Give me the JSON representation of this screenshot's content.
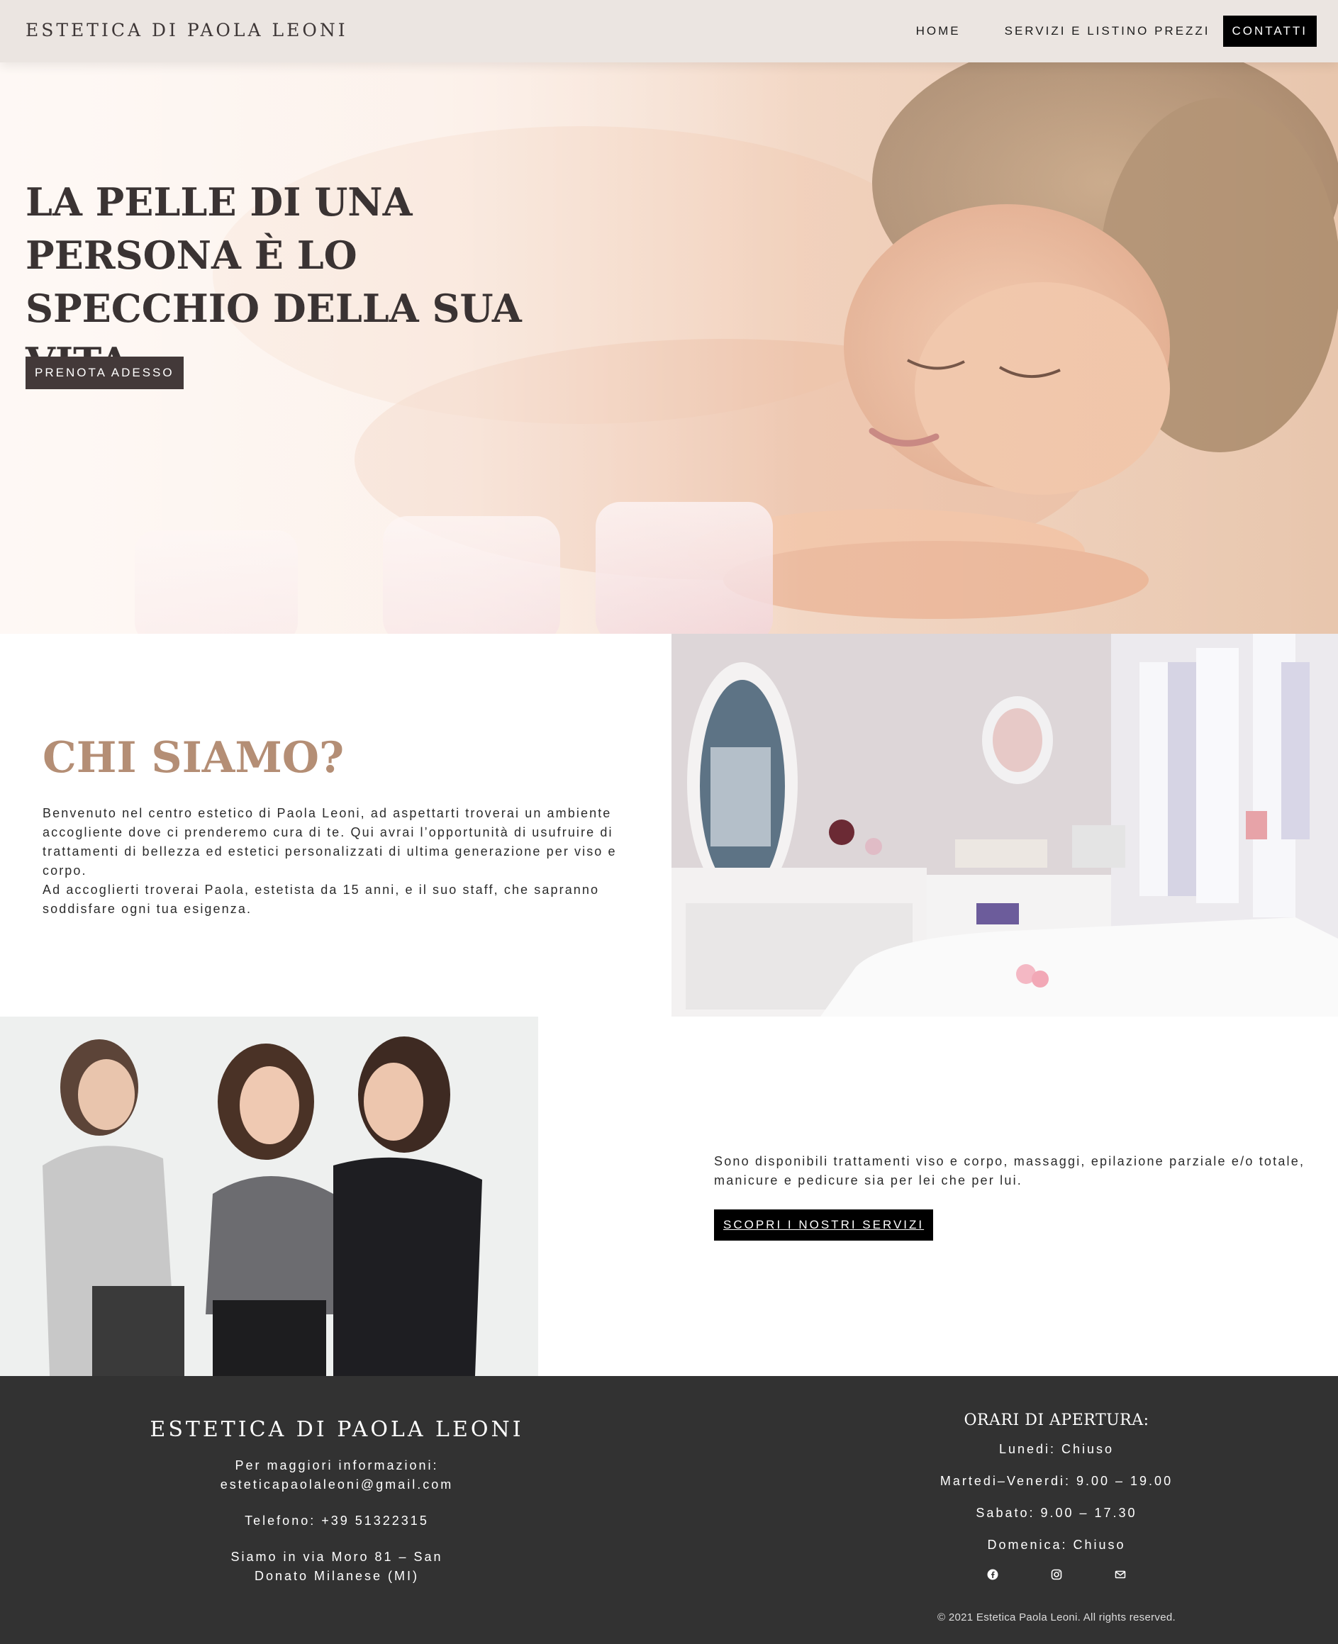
{
  "header": {
    "brand": "ESTETICA DI PAOLA LEONI",
    "nav": [
      {
        "label": "HOME"
      },
      {
        "label": "SERVIZI E LISTINO PREZZI"
      },
      {
        "label": "CONTATTI"
      }
    ]
  },
  "hero": {
    "title": "LA PELLE DI UNA PERSONA È LO SPECCHIO DELLA SUA VITA",
    "cta": "PRENOTA ADESSO"
  },
  "about": {
    "title": "CHI SIAMO?",
    "paragraph_1": "Benvenuto nel centro estetico di Paola Leoni, ad aspettarti troverai un ambiente accogliente dove ci prenderemo cura di te. Qui avrai l’opportunità di usufruire di trattamenti di bellezza ed estetici personalizzati di ultima generazione per viso e corpo.",
    "paragraph_2": "Ad accoglierti troverai Paola, estetista da 15 anni, e il suo staff, che sapranno soddisfare ogni tua esigenza."
  },
  "services": {
    "text": "Sono disponibili trattamenti viso e corpo, massaggi, epilazione parziale e/o totale, manicure e pedicure sia per lei che per lui.",
    "cta": "SCOPRI I NOSTRI SERVIZI"
  },
  "footer": {
    "brand": "ESTETICA DI PAOLA LEONI",
    "info_label": "Per maggiori informazioni:",
    "email": "esteticapaolaleoni@gmail.com",
    "phone": "Telefono: +39 51322315",
    "address_1": "Siamo in via Moro 81 – San",
    "address_2": "Donato Milanese (MI)",
    "hours_title": "ORARI DI APERTURA:",
    "hours": [
      {
        "text": "Lunedi: Chiuso"
      },
      {
        "text": "Martedi–Venerdi: 9.00 – 19.00"
      },
      {
        "text": "Sabato: 9.00 – 17.30"
      },
      {
        "text": "Domenica: Chiuso"
      }
    ],
    "social_icons": [
      "facebook-icon",
      "instagram-icon",
      "envelope-icon"
    ],
    "copyright": "© 2021 Estetica Paola Leoni. All rights reserved."
  },
  "colors": {
    "header_bg": "#ebe5e1",
    "accent": "#b48e75",
    "dark_button": "#433939",
    "footer_bg": "#323232"
  }
}
